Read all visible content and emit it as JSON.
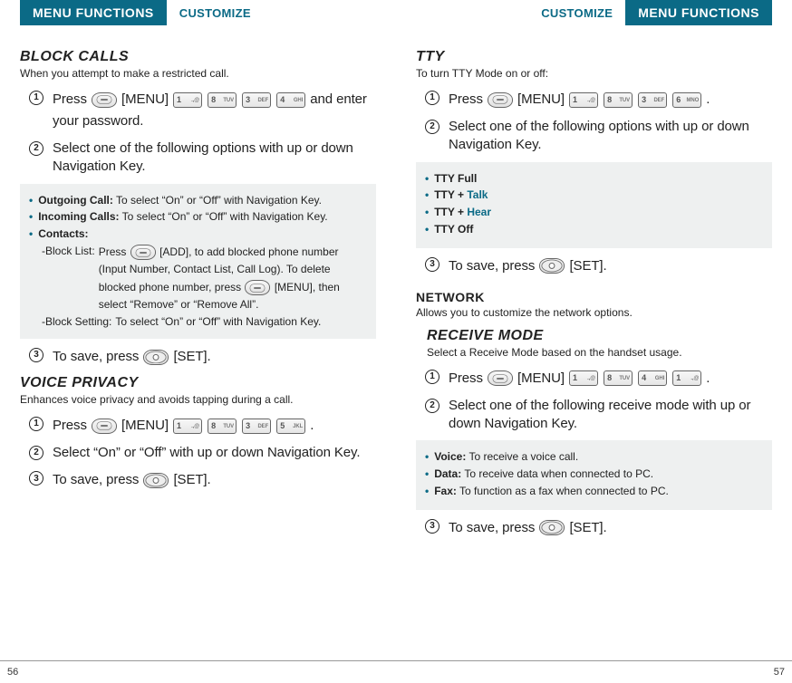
{
  "header": {
    "tab": "MENU FUNCTIONS",
    "crumb": "CUSTOMIZE"
  },
  "left": {
    "page_num": "56",
    "block_calls": {
      "title": "BLOCK CALLS",
      "sub": "When you attempt to make a restricted call.",
      "step1_a": "Press",
      "step1_menu": "[MENU]",
      "step1_b": "and enter your password.",
      "keys1": [
        "1",
        "8",
        "3",
        "4"
      ],
      "step2": "Select one of the following options with up or down Navigation Key.",
      "box": {
        "outgoing_label": "Outgoing Call:",
        "outgoing_desc": "To select “On” or “Off” with Navigation Key.",
        "incoming_label": "Incoming Calls:",
        "incoming_desc": "To select “On” or “Off” with Navigation Key.",
        "contacts_label": "Contacts:",
        "bl_label": "-Block List:",
        "bl_a": "Press",
        "bl_add": "[ADD], to add blocked phone number (Input Number, Contact List, Call Log). To delete blocked phone number, press",
        "bl_menu_tail": "[MENU], then select “Remove” or “Remove All”.",
        "bs_label": "-Block Setting:",
        "bs_desc": "To select “On” or “Off” with Navigation Key."
      },
      "step3_a": "To save, press",
      "step3_b": "[SET]."
    },
    "voice_privacy": {
      "title": "VOICE PRIVACY",
      "sub": "Enhances voice privacy and avoids tapping during a call.",
      "step1_a": "Press",
      "step1_menu": "[MENU]",
      "keys1": [
        "1",
        "8",
        "3",
        "5"
      ],
      "step1_dot": ".",
      "step2": "Select “On” or “Off” with up or down Navigation Key.",
      "step3_a": "To save, press",
      "step3_b": "[SET]."
    }
  },
  "right": {
    "page_num": "57",
    "tty": {
      "title": "TTY",
      "sub": "To turn TTY Mode on or off:",
      "step1_a": "Press",
      "step1_menu": "[MENU]",
      "keys1": [
        "1",
        "8",
        "3",
        "6"
      ],
      "step1_dot": ".",
      "step2": "Select one of the following options with up or down Navigation Key.",
      "box": {
        "i1": "TTY Full",
        "i2a": "TTY + ",
        "i2b": "Talk",
        "i3a": "TTY + ",
        "i3b": "Hear",
        "i4": "TTY Off"
      },
      "step3_a": "To save, press",
      "step3_b": "[SET]."
    },
    "network": {
      "title": "NETWORK",
      "sub": "Allows you to customize the network options."
    },
    "receive": {
      "title": "RECEIVE MODE",
      "sub": "Select a Receive Mode based on the handset usage.",
      "step1_a": "Press",
      "step1_menu": "[MENU]",
      "keys1": [
        "1",
        "8",
        "4",
        "1"
      ],
      "step1_dot": ".",
      "step2": "Select one of the following receive mode with up or down Navigation Key.",
      "box": {
        "v_label": "Voice:",
        "v_desc": "To receive a voice call.",
        "d_label": "Data:",
        "d_desc": "To receive data when connected to PC.",
        "f_label": "Fax:",
        "f_desc": "To function as a fax when connected to PC."
      },
      "step3_a": "To save, press",
      "step3_b": "[SET]."
    }
  }
}
